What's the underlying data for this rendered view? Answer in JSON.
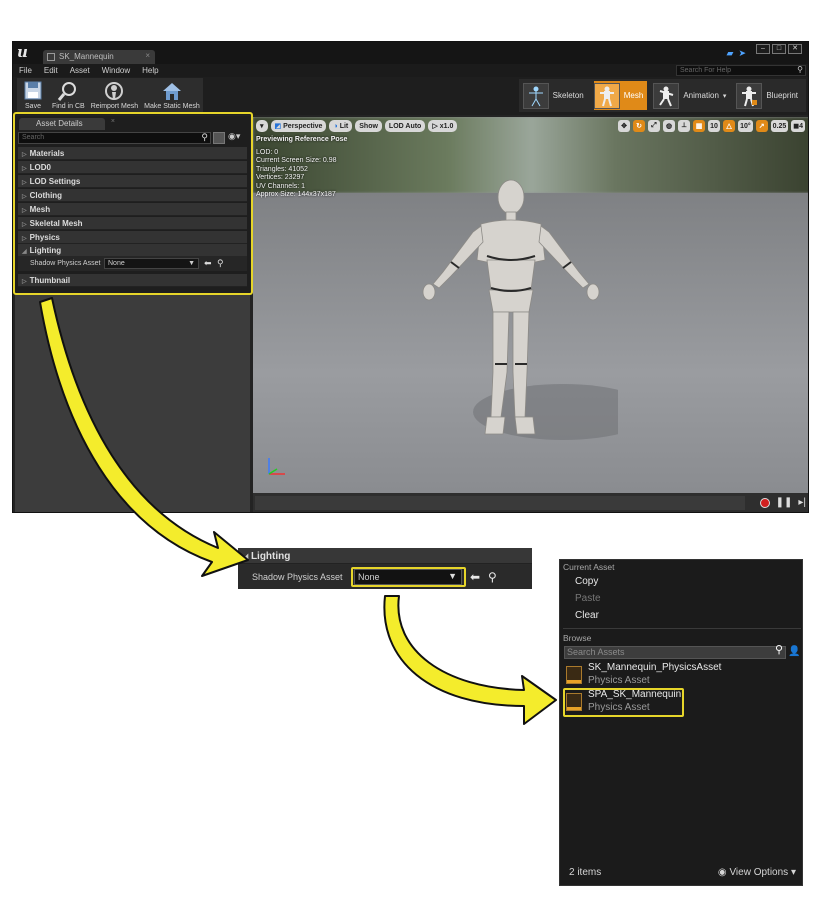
{
  "editor": {
    "document_tab": "SK_Mannequin",
    "menus": [
      "File",
      "Edit",
      "Asset",
      "Window",
      "Help"
    ],
    "help_search_placeholder": "Search For Help",
    "toolbar": [
      {
        "label": "Save",
        "icon": "save-icon"
      },
      {
        "label": "Find in CB",
        "icon": "magnifier-icon"
      },
      {
        "label": "Reimport Mesh",
        "icon": "reimport-icon"
      },
      {
        "label": "Make Static Mesh",
        "icon": "house-icon"
      }
    ],
    "modes": [
      {
        "label": "Skeleton",
        "active": false
      },
      {
        "label": "Mesh",
        "active": true
      },
      {
        "label": "Animation",
        "active": false
      },
      {
        "label": "Blueprint",
        "active": false
      }
    ],
    "accent_color": "#e08a18",
    "highlight_color": "#e6d52a"
  },
  "details": {
    "tab_label": "Asset Details",
    "search_placeholder": "Search",
    "categories": [
      "Materials",
      "LOD0",
      "LOD Settings",
      "Clothing",
      "Mesh",
      "Skeletal Mesh",
      "Physics",
      "Lighting",
      "Thumbnail"
    ],
    "lighting_expanded": true,
    "property_label": "Shadow Physics Asset",
    "property_value": "None"
  },
  "viewport": {
    "toolbar": [
      "Perspective",
      "Lit",
      "Show",
      "LOD Auto",
      "x1.0"
    ],
    "right_tools": [
      "10",
      "10°",
      "0.25",
      "4"
    ],
    "info": {
      "title": "Previewing Reference Pose",
      "lines": [
        "LOD: 0",
        "Current Screen Size: 0.98",
        "Triangles: 41052",
        "Vertices: 23297",
        "UV Channels: 1",
        "Approx Size: 144x37x187"
      ]
    }
  },
  "zoom": {
    "section": "Lighting",
    "property_label": "Shadow Physics Asset",
    "property_value": "None"
  },
  "picker": {
    "current_asset_header": "Current Asset",
    "copy": "Copy",
    "paste": "Paste",
    "clear": "Clear",
    "browse_header": "Browse",
    "search_placeholder": "Search Assets",
    "assets": [
      {
        "name": "SK_Mannequin_PhysicsAsset",
        "type": "Physics Asset",
        "highlighted": false
      },
      {
        "name": "SPA_SK_Mannequin",
        "type": "Physics Asset",
        "highlighted": true
      }
    ],
    "count": "2 items",
    "view_options": "View Options"
  }
}
